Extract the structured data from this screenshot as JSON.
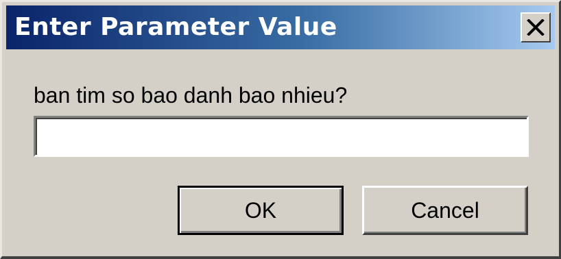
{
  "window": {
    "title": "Enter Parameter Value",
    "close_icon": "close-icon"
  },
  "form": {
    "prompt": "ban tim so bao danh bao nhieu?",
    "input_value": "",
    "input_placeholder": ""
  },
  "buttons": {
    "ok_label": "OK",
    "cancel_label": "Cancel"
  },
  "colors": {
    "titlebar_start": "#0a246a",
    "titlebar_end": "#a6caf0",
    "face": "#d4d0c8"
  }
}
